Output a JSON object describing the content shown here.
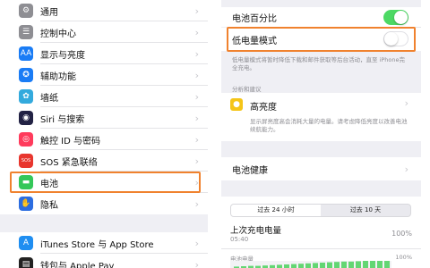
{
  "left": {
    "group1": [
      {
        "name": "general",
        "label": "通用",
        "icon": "gear-icon",
        "color": "#8e8e93",
        "glyph": "⚙"
      },
      {
        "name": "control-center",
        "label": "控制中心",
        "icon": "sliders-icon",
        "color": "#8e8e93",
        "glyph": "☰"
      },
      {
        "name": "display",
        "label": "显示与亮度",
        "icon": "text-size-icon",
        "color": "#1a7cf5",
        "glyph": "AA"
      },
      {
        "name": "accessibility",
        "label": "辅助功能",
        "icon": "accessibility-icon",
        "color": "#1a7cf5",
        "glyph": "✪"
      },
      {
        "name": "wallpaper",
        "label": "墙纸",
        "icon": "flower-icon",
        "color": "#33aadd",
        "glyph": "✿"
      },
      {
        "name": "siri",
        "label": "Siri 与搜索",
        "icon": "siri-icon",
        "color": "#222244",
        "glyph": "◉"
      },
      {
        "name": "touch-id",
        "label": "触控 ID 与密码",
        "icon": "fingerprint-icon",
        "color": "#ff3b5c",
        "glyph": "◎"
      },
      {
        "name": "sos",
        "label": "SOS 紧急联络",
        "icon": "sos-icon",
        "color": "#e8362e",
        "glyph": "SOS"
      },
      {
        "name": "battery",
        "label": "电池",
        "icon": "battery-icon",
        "color": "#34c759",
        "glyph": "▬"
      },
      {
        "name": "privacy",
        "label": "隐私",
        "icon": "hand-icon",
        "color": "#2c6de0",
        "glyph": "✋"
      }
    ],
    "group2": [
      {
        "name": "itunes",
        "label": "iTunes Store 与 App Store",
        "icon": "app-store-icon",
        "color": "#1f8ef1",
        "glyph": "A"
      },
      {
        "name": "wallet",
        "label": "钱包与 Apple Pay",
        "icon": "wallet-icon",
        "color": "#222222",
        "glyph": "▤"
      }
    ]
  },
  "right": {
    "battery_percentage_label": "电池百分比",
    "low_power_label": "低电量模式",
    "low_power_note": "低电量模式将暂时降低下载和邮件获取等后台活动，直至 iPhone完全充电。",
    "insights_header": "分析和建议",
    "brightness_label": "高亮度",
    "brightness_note": "显示屏亮度高会消耗大量的电量。请考虑降低亮度以改善电池续航能力。",
    "health_label": "电池健康",
    "seg_24h": "过去 24 小时",
    "seg_10d": "过去 10 天",
    "last_charge_label": "上次充电电量",
    "last_charge_time": "05:40",
    "last_charge_value": "100%",
    "battery_level_label": "电池电量",
    "chart_top_value": "100%"
  },
  "colors": {
    "highlight": "#f0822e",
    "toggle_on": "#4cd964",
    "chart_green": "#63d673"
  }
}
